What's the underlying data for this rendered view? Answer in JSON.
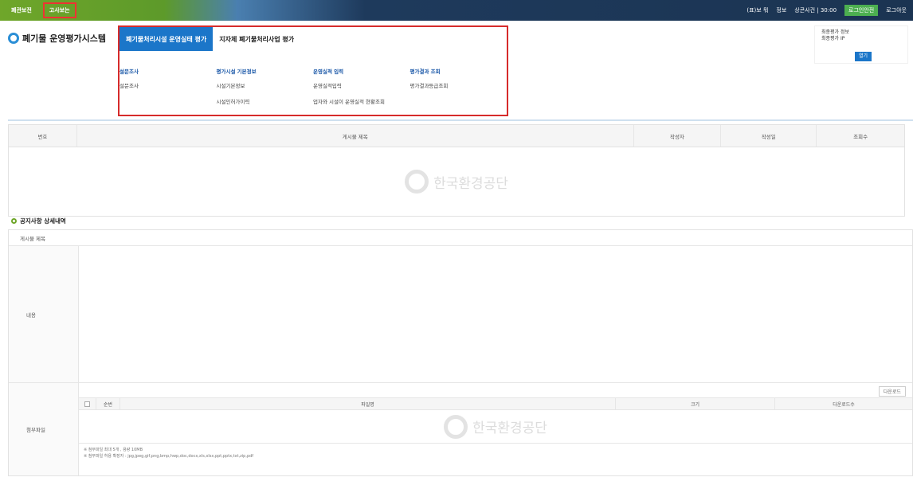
{
  "topbar": {
    "links": [
      "폐관보전",
      "고사보는"
    ],
    "right_items": [
      "(표)보 뭐",
      "정보",
      "상콘사건 | 30:00",
      "로그인안전",
      "로그아웃"
    ]
  },
  "header": {
    "logo_text": "폐기물 운영평가시스템"
  },
  "megamenu": {
    "tabs": [
      "폐기물처리시설 운영실태 평가",
      "지자체 폐기물처리사업 평가"
    ],
    "columns": [
      {
        "title": "설문조사",
        "items": [
          "설문조사"
        ]
      },
      {
        "title": "평가시설 기본정보",
        "items": [
          "시설기본정보",
          "시설인허가이력"
        ]
      },
      {
        "title": "운영실적 입력",
        "items": [
          "운영실적입력",
          "업자와 시설이 운영실적 현황조회"
        ]
      },
      {
        "title": "평가결과 조회",
        "items": [
          "평가결과등급조회"
        ]
      }
    ]
  },
  "loginbox": {
    "line1": "최종평가 정보",
    "line2": "최종평가 IP",
    "button": "열기"
  },
  "list_table": {
    "headers": [
      "번호",
      "게시물 제목",
      "작성자",
      "작성일",
      "조회수"
    ],
    "watermark": "한국환경공단"
  },
  "detail": {
    "section_title": "공지사항 상세내역",
    "title_label": "게시물 제목",
    "content_label": "내용",
    "files_label": "첨부파일",
    "download_button": "다운로드",
    "file_headers": [
      "순번",
      "파일명",
      "크기",
      "다운로드수"
    ],
    "watermark": "한국환경공단",
    "notes": [
      "※ 첨부파일 최대 5개 , 용량 10MB",
      "※ 첨부파일 허용 확장자 : jpg,jpeg,gif,png,bmp,hwp,doc,docx,xls,xlsx,ppt,pptx,txt,zip,pdf"
    ]
  }
}
